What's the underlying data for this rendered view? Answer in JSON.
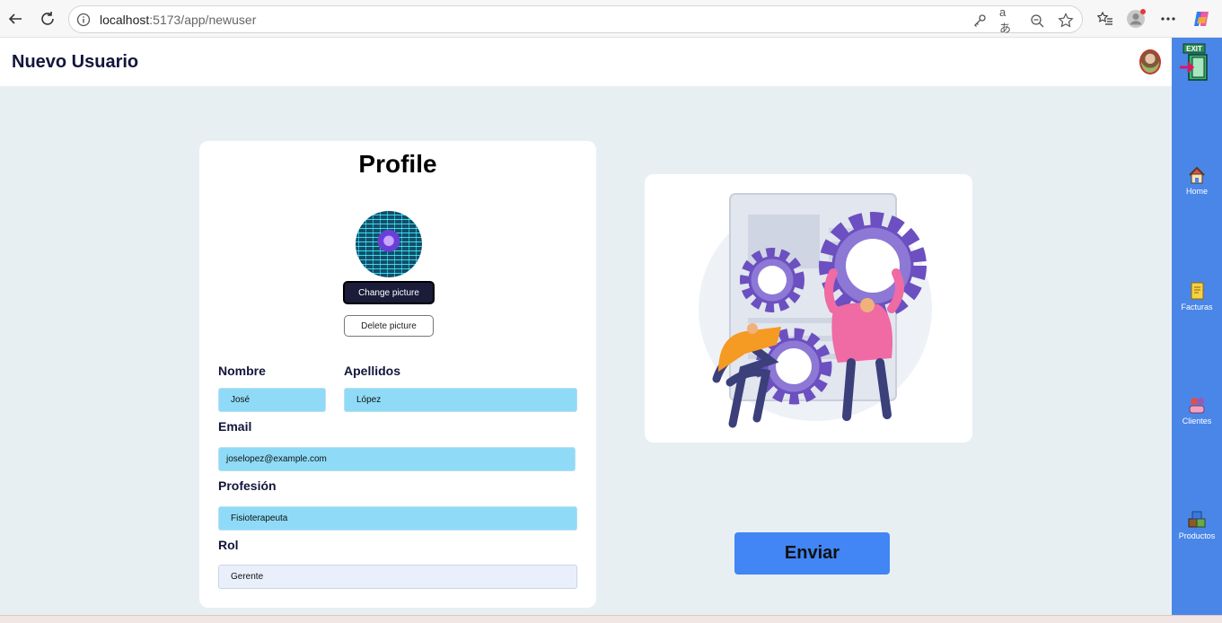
{
  "browser": {
    "url_host": "localhost",
    "url_rest": ":5173/app/newuser"
  },
  "app": {
    "title": "Nuevo Usuario"
  },
  "sidebar": {
    "exit_label": "EXIT",
    "items": [
      {
        "label": "Home",
        "icon": "house-icon"
      },
      {
        "label": "Facturas",
        "icon": "invoice-icon"
      },
      {
        "label": "Clientes",
        "icon": "clients-icon"
      },
      {
        "label": "Productos",
        "icon": "products-icon"
      }
    ]
  },
  "profile": {
    "title": "Profile",
    "change_picture_label": "Change picture",
    "delete_picture_label": "Delete picture",
    "fields": {
      "nombre_label": "Nombre",
      "nombre_value": "José",
      "apellidos_label": "Apellidos",
      "apellidos_value": "López",
      "email_label": "Email",
      "email_value": "joselopez@example.com",
      "profesion_label": "Profesión",
      "profesion_value": "Fisioterapeuta",
      "rol_label": "Rol",
      "rol_value": "Gerente"
    }
  },
  "actions": {
    "submit_label": "Enviar"
  },
  "colors": {
    "sidebar": "#4a86e8",
    "primary_button": "#4285f4",
    "input_bg": "#8fdbf7",
    "dark_button": "#1b1c3a"
  }
}
